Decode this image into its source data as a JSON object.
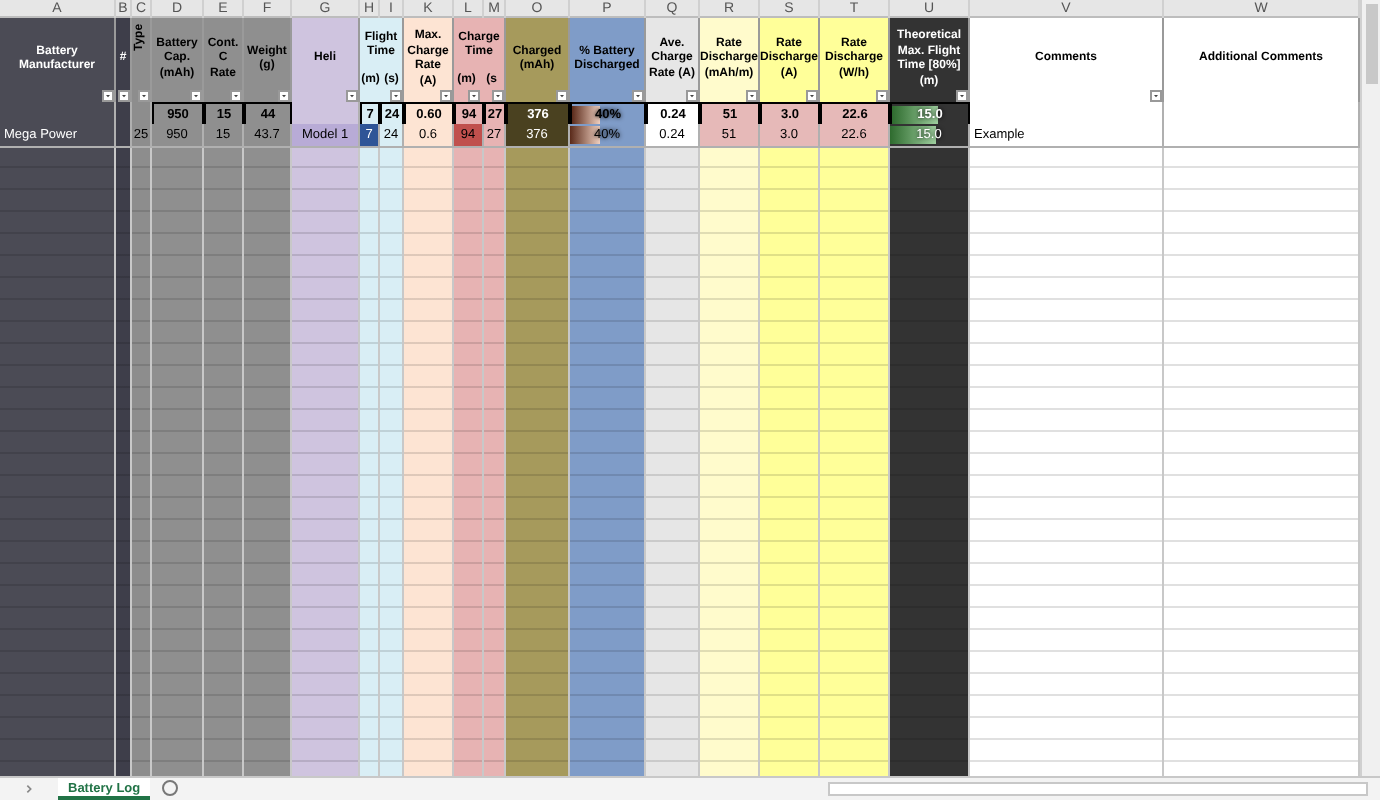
{
  "columns": [
    {
      "letter": "A",
      "header": "Battery Manufacturer",
      "color": "#4b4b55",
      "filter": true
    },
    {
      "letter": "B",
      "header": "#",
      "color": "#3e3e4a",
      "filter": true
    },
    {
      "letter": "C",
      "header": "Type",
      "color": "#8d8d8d",
      "filter": true,
      "rotated": true
    },
    {
      "letter": "D",
      "header": "Battery Cap. (mAh)",
      "color": "#8f8f8f",
      "filter": true
    },
    {
      "letter": "E",
      "header": "Cont. C Rate",
      "color": "#8f8f8f",
      "filter": true
    },
    {
      "letter": "F",
      "header": "Weight (g)",
      "color": "#8f8f8f",
      "filter": true
    },
    {
      "letter": "G",
      "header": "Heli",
      "color": "#cfc4df",
      "filter": true
    },
    {
      "letter": "H",
      "header": "Flight Time",
      "sub": "(m)",
      "color": "#d9eef5",
      "filter": false
    },
    {
      "letter": "I",
      "sub": "(s)",
      "color": "#d9eef5",
      "filter": true
    },
    {
      "letter": "K",
      "header": "Max. Charge Rate (A)",
      "color": "#fde4d3",
      "filter": true
    },
    {
      "letter": "L",
      "header": "Charge Time",
      "sub": "(m)",
      "color": "#e7b3b3",
      "filter": true
    },
    {
      "letter": "M",
      "sub": "(s",
      "color": "#e7b3b3",
      "filter": true
    },
    {
      "letter": "O",
      "header": "Charged (mAh)",
      "color": "#a69a5c",
      "filter": true
    },
    {
      "letter": "P",
      "header": "% Battery Discharged",
      "color": "#7f9cc8",
      "filter": true
    },
    {
      "letter": "Q",
      "header": "Ave. Charge Rate (A)",
      "color": "#e6e6e6",
      "filter": true
    },
    {
      "letter": "R",
      "header": "Rate Discharge (mAh/m)",
      "color": "#fffbcc",
      "filter": true
    },
    {
      "letter": "S",
      "header": "Rate Discharge (A)",
      "color": "#ffff99",
      "filter": true
    },
    {
      "letter": "T",
      "header": "Rate Discharge (W/h)",
      "color": "#ffff99",
      "filter": true
    },
    {
      "letter": "U",
      "header": "Theoretical Max. Flight Time [80%] (m)",
      "color": "#333333",
      "filter": true
    },
    {
      "letter": "V",
      "header": "Comments",
      "color": "#ffffff",
      "filter": true
    },
    {
      "letter": "W",
      "header": "Additional Comments",
      "color": "#ffffff",
      "filter": false
    }
  ],
  "summary_row": {
    "D": {
      "text": "950"
    },
    "E": {
      "text": "15"
    },
    "F": {
      "text": "44"
    },
    "H": {
      "text": "7"
    },
    "I": {
      "text": "24"
    },
    "K": {
      "text": "0.60"
    },
    "L": {
      "text": "94"
    },
    "M": {
      "text": "27"
    },
    "O": {
      "text": "376",
      "color": "#4a4120"
    },
    "P": {
      "text": "40%",
      "level": 0.4
    },
    "Q": {
      "text": "0.24",
      "color": "#ffffff"
    },
    "R": {
      "text": "51",
      "color": "#e6b9b8"
    },
    "S": {
      "text": "3.0",
      "color": "#e6b9b8"
    },
    "T": {
      "text": "22.6",
      "color": "#e6b9b8"
    },
    "U": {
      "text": "15.0",
      "level": 0.6
    }
  },
  "data_rows": [
    {
      "A": {
        "text": "Mega Power"
      },
      "C": {
        "text": "25"
      },
      "D": {
        "text": "950"
      },
      "E": {
        "text": "15"
      },
      "F": {
        "text": "43.7"
      },
      "G": {
        "text": "Model 1",
        "color": "#b8abd6"
      },
      "H": {
        "text": "7",
        "color": "#2f5597"
      },
      "I": {
        "text": "24"
      },
      "K": {
        "text": "0.6"
      },
      "L": {
        "text": "94",
        "color": "#c0504d"
      },
      "M": {
        "text": "27"
      },
      "O": {
        "text": "376",
        "color": "#4a4120"
      },
      "P": {
        "text": "40%",
        "level": 0.4
      },
      "Q": {
        "text": "0.24",
        "color": "#ffffff"
      },
      "R": {
        "text": "51",
        "color": "#e6b9b8"
      },
      "S": {
        "text": "3.0",
        "color": "#e6b9b8"
      },
      "T": {
        "text": "22.6",
        "color": "#e6b9b8"
      },
      "U": {
        "text": "15.0",
        "level": 0.6
      },
      "V": {
        "text": "Example"
      }
    }
  ],
  "sheet_tabs": [
    {
      "label": "Battery Log",
      "selected": true
    }
  ]
}
